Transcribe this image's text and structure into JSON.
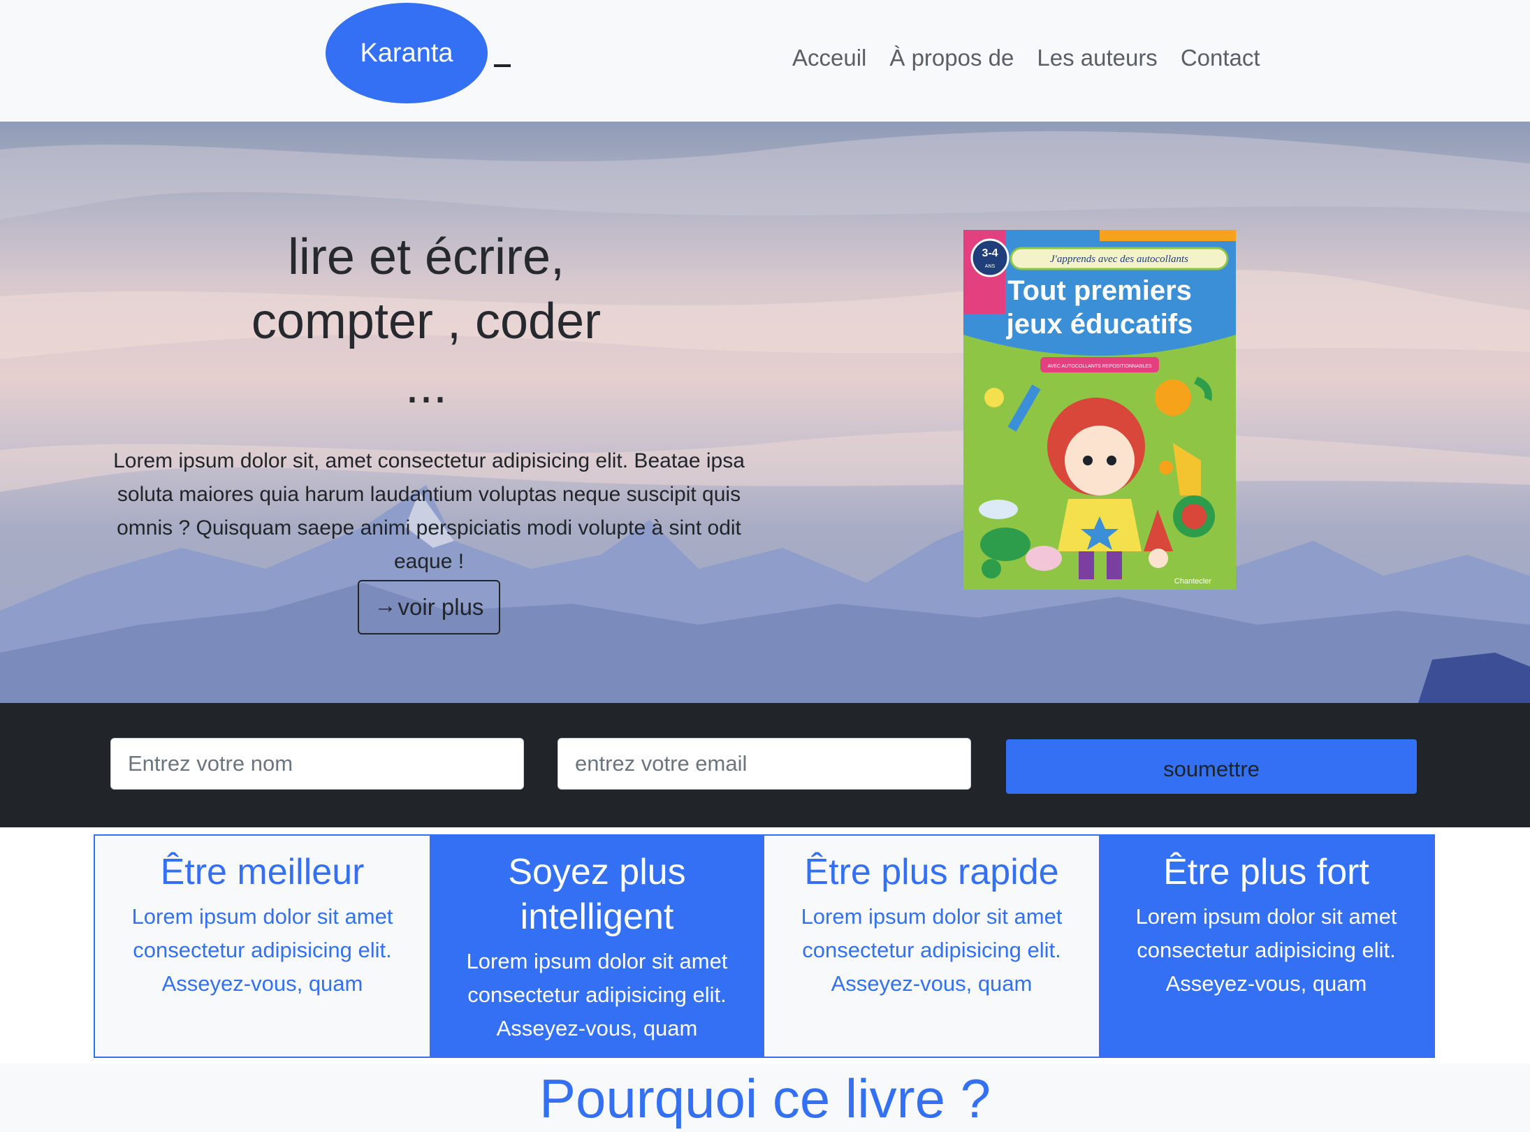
{
  "navbar": {
    "brand": "Karanta",
    "toggler_icon": "menu-bar-icon",
    "links": [
      "Acceuil",
      "À propos de",
      "Les auteurs",
      "Contact"
    ]
  },
  "hero": {
    "title_line1": "lire et écrire,",
    "title_line2": "compter , coder",
    "title_line3": "...",
    "text": "Lorem ipsum dolor sit, amet consectetur adipisicing elit. Beatae ipsa soluta maiores quia harum laudantium voluptas neque suscipit quis omnis ? Quisquam saepe animi perspiciatis modi volupte à sint odit eaque !",
    "button_icon": "arrow-right-icon",
    "button_arrow": "→",
    "button_label": "voir plus",
    "book": {
      "age": "3-4",
      "age_unit": "ANS",
      "tagline": "J'apprends avec des autocollants",
      "title_line1": "Tout premiers",
      "title_line2": "jeux éducatifs",
      "subtitle": "AVEC AUTOCOLLANTS REPOSITIONNABLES",
      "publisher": "Chantecler"
    }
  },
  "form": {
    "name_placeholder": "Entrez votre nom",
    "email_placeholder": "entrez votre email",
    "submit_label": "soumettre"
  },
  "features": [
    {
      "title": "Être meilleur",
      "text": "Lorem ipsum dolor sit amet consectetur adipisicing elit. Asseyez-vous, quam"
    },
    {
      "title": "Soyez plus intelligent",
      "text": "Lorem ipsum dolor sit amet consectetur adipisicing elit. Asseyez-vous, quam"
    },
    {
      "title": "Être plus rapide",
      "text": "Lorem ipsum dolor sit amet consectetur adipisicing elit. Asseyez-vous, quam"
    },
    {
      "title": "Être plus fort",
      "text": "Lorem ipsum dolor sit amet consectetur adipisicing elit. Asseyez-vous, quam"
    }
  ],
  "section": {
    "title": "Pourquoi ce livre ?"
  },
  "colors": {
    "primary": "#3370f3",
    "dark": "#212529",
    "light": "#f8f9fa"
  }
}
